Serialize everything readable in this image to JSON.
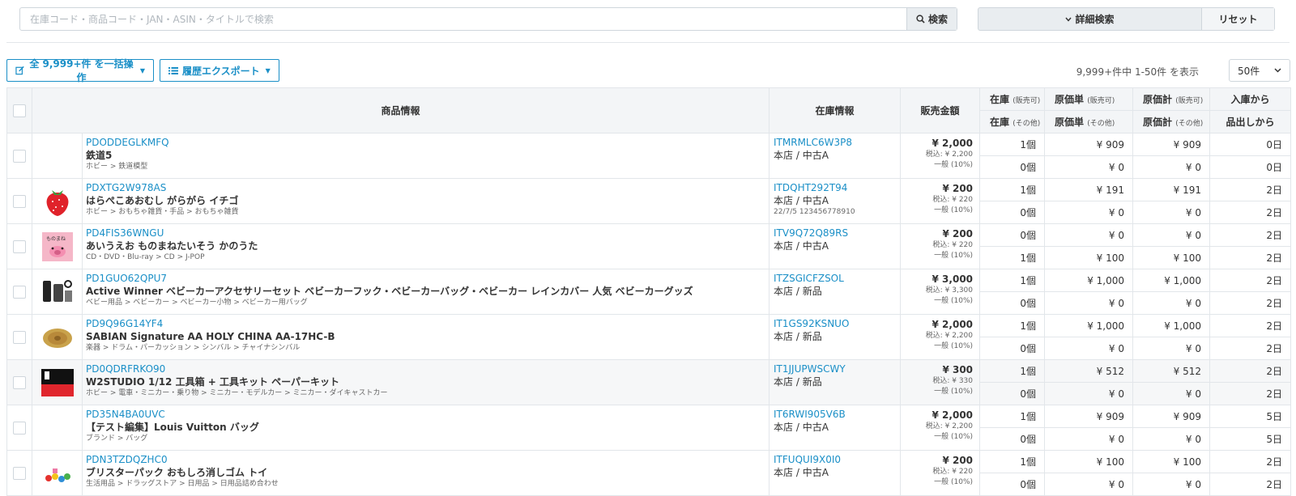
{
  "search": {
    "placeholder": "在庫コード・商品コード・JAN・ASIN・タイトルで検索",
    "button_label": "検索"
  },
  "advanced": {
    "label": "詳細検索",
    "reset_label": "リセット"
  },
  "actions": {
    "bulk_label": "全 9,999+件 を一括操作",
    "export_label": "履歴エクスポート"
  },
  "pager": {
    "summary": "9,999+件中 1-50件 を表示",
    "per_page": "50件"
  },
  "headers": {
    "product_info": "商品情報",
    "stock_info": "在庫情報",
    "sale_price": "販売金額",
    "stock": "在庫",
    "unit_cost": "原価単",
    "total_cost": "原価計",
    "sub_available": "(販売可)",
    "sub_other": "(その他)",
    "since_in": "入庫から",
    "since_out": "品出しから"
  },
  "rows": [
    {
      "code": "PDODDEGLKMFQ",
      "title": "鉄道5",
      "category": "ホビー > 鉄道模型",
      "image": "none",
      "stock_code": "ITMRMLC6W3P8",
      "location": "本店 / 中古A",
      "extra": "",
      "price": "¥ 2,000",
      "tax": "税込: ¥ 2,200",
      "tax_type": "一般 (10%)",
      "stock_avail": "1個",
      "stock_other": "0個",
      "cost_avail": "¥ 909",
      "cost_other": "¥ 0",
      "total_avail": "¥ 909",
      "total_other": "¥ 0",
      "days_in": "0日",
      "days_out": "0日"
    },
    {
      "code": "PDXTG2W978AS",
      "title": "はらぺこあおむし がらがら イチゴ",
      "category": "ホビー > おもちゃ雑貨・手品 > おもちゃ雑貨",
      "image": "strawberry-image",
      "stock_code": "ITDQHT292T94",
      "location": "本店 / 中古A",
      "extra": "22/7/5 123456778910",
      "price": "¥ 200",
      "tax": "税込: ¥ 220",
      "tax_type": "一般 (10%)",
      "stock_avail": "1個",
      "stock_other": "0個",
      "cost_avail": "¥ 191",
      "cost_other": "¥ 0",
      "total_avail": "¥ 191",
      "total_other": "¥ 0",
      "days_in": "2日",
      "days_out": "2日"
    },
    {
      "code": "PD4FIS36WNGU",
      "title": "あいうえお ものまねたいそう かのうた",
      "category": "CD・DVD・Blu-ray > CD > J-POP",
      "image": "pig-cover-image",
      "stock_code": "ITV9Q72Q89RS",
      "location": "本店 / 中古A",
      "extra": "",
      "price": "¥ 200",
      "tax": "税込: ¥ 220",
      "tax_type": "一般 (10%)",
      "stock_avail": "0個",
      "stock_other": "1個",
      "cost_avail": "¥ 0",
      "cost_other": "¥ 100",
      "total_avail": "¥ 0",
      "total_other": "¥ 100",
      "days_in": "2日",
      "days_out": "2日"
    },
    {
      "code": "PD1GUO62QPU7",
      "title": "Active Winner ベビーカーアクセサリーセット ベビーカーフック・ベビーカーバッグ・ベビーカー レインカバー 人気 ベビーカーグッズ",
      "category": "ベビー用品 > ベビーカー > ベビーカー小物 > ベビーカー用バッグ",
      "image": "stroller-accessories-image",
      "stock_code": "ITZSGICFZSOL",
      "location": "本店 / 新品",
      "extra": "",
      "price": "¥ 3,000",
      "tax": "税込: ¥ 3,300",
      "tax_type": "一般 (10%)",
      "stock_avail": "1個",
      "stock_other": "0個",
      "cost_avail": "¥ 1,000",
      "cost_other": "¥ 0",
      "total_avail": "¥ 1,000",
      "total_other": "¥ 0",
      "days_in": "2日",
      "days_out": "2日"
    },
    {
      "code": "PD9Q96G14YF4",
      "title": "SABIAN Signature AA HOLY CHINA AA-17HC-B",
      "category": "楽器 > ドラム・パーカッション > シンバル > チャイナシンバル",
      "image": "cymbal-image",
      "stock_code": "IT1GS92KSNUO",
      "location": "本店 / 新品",
      "extra": "",
      "price": "¥ 2,000",
      "tax": "税込: ¥ 2,200",
      "tax_type": "一般 (10%)",
      "stock_avail": "1個",
      "stock_other": "0個",
      "cost_avail": "¥ 1,000",
      "cost_other": "¥ 0",
      "total_avail": "¥ 1,000",
      "total_other": "¥ 0",
      "days_in": "2日",
      "days_out": "2日"
    },
    {
      "code": "PD0QDRFRKO90",
      "title": "W2STUDIO 1/12 工具箱 + 工具キット ペーパーキット",
      "category": "ホビー > 電車・ミニカー・乗り物 > ミニカー・モデルカー > ミニカー・ダイキャストカー",
      "image": "toolbox-image",
      "stock_code": "IT1JJUPWSCWY",
      "location": "本店 / 新品",
      "extra": "",
      "price": "¥ 300",
      "tax": "税込: ¥ 330",
      "tax_type": "一般 (10%)",
      "stock_avail": "1個",
      "stock_other": "0個",
      "cost_avail": "¥ 512",
      "cost_other": "¥ 0",
      "total_avail": "¥ 512",
      "total_other": "¥ 0",
      "days_in": "2日",
      "days_out": "2日"
    },
    {
      "code": "PD35N4BA0UVC",
      "title": "【テスト編集】Louis Vuitton バッグ",
      "category": "ブランド > バッグ",
      "image": "none",
      "stock_code": "IT6RWI905V6B",
      "location": "本店 / 中古A",
      "extra": "",
      "price": "¥ 2,000",
      "tax": "税込: ¥ 2,200",
      "tax_type": "一般 (10%)",
      "stock_avail": "1個",
      "stock_other": "0個",
      "cost_avail": "¥ 909",
      "cost_other": "¥ 0",
      "total_avail": "¥ 909",
      "total_other": "¥ 0",
      "days_in": "5日",
      "days_out": "5日"
    },
    {
      "code": "PDN3TZDQZHC0",
      "title": "ブリスターパック おもしろ消しゴム トイ",
      "category": "生活用品 > ドラッグストア > 日用品 > 日用品詰め合わせ",
      "image": "eraser-toys-image",
      "stock_code": "ITFUQUI9X0I0",
      "location": "本店 / 中古A",
      "extra": "",
      "price": "¥ 200",
      "tax": "税込: ¥ 220",
      "tax_type": "一般 (10%)",
      "stock_avail": "1個",
      "stock_other": "0個",
      "cost_avail": "¥ 100",
      "cost_other": "¥ 0",
      "total_avail": "¥ 100",
      "total_other": "¥ 0",
      "days_in": "2日",
      "days_out": "2日"
    }
  ],
  "colors": {
    "link": "#1a8fc7",
    "header_bg": "#f3f5f7",
    "border": "#e2e6ea"
  }
}
